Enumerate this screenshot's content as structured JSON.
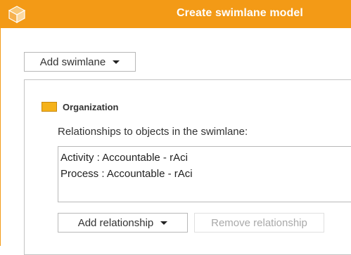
{
  "window": {
    "title": "Create swimlane model",
    "accent_color": "#f39a16",
    "icon": "cube-icon"
  },
  "toolbar": {
    "add_swimlane_label": "Add swimlane",
    "add_swimlane_icon": "caret-down-icon"
  },
  "swimlane": {
    "name": "Organization",
    "swatch_color": "#f5b21a",
    "relationships_label": "Relationships to objects in the swimlane:",
    "relationships": [
      "Activity : Accountable - rAci",
      "Process : Accountable - rAci"
    ],
    "add_relationship_label": "Add relationship",
    "remove_relationship_label": "Remove relationship"
  }
}
